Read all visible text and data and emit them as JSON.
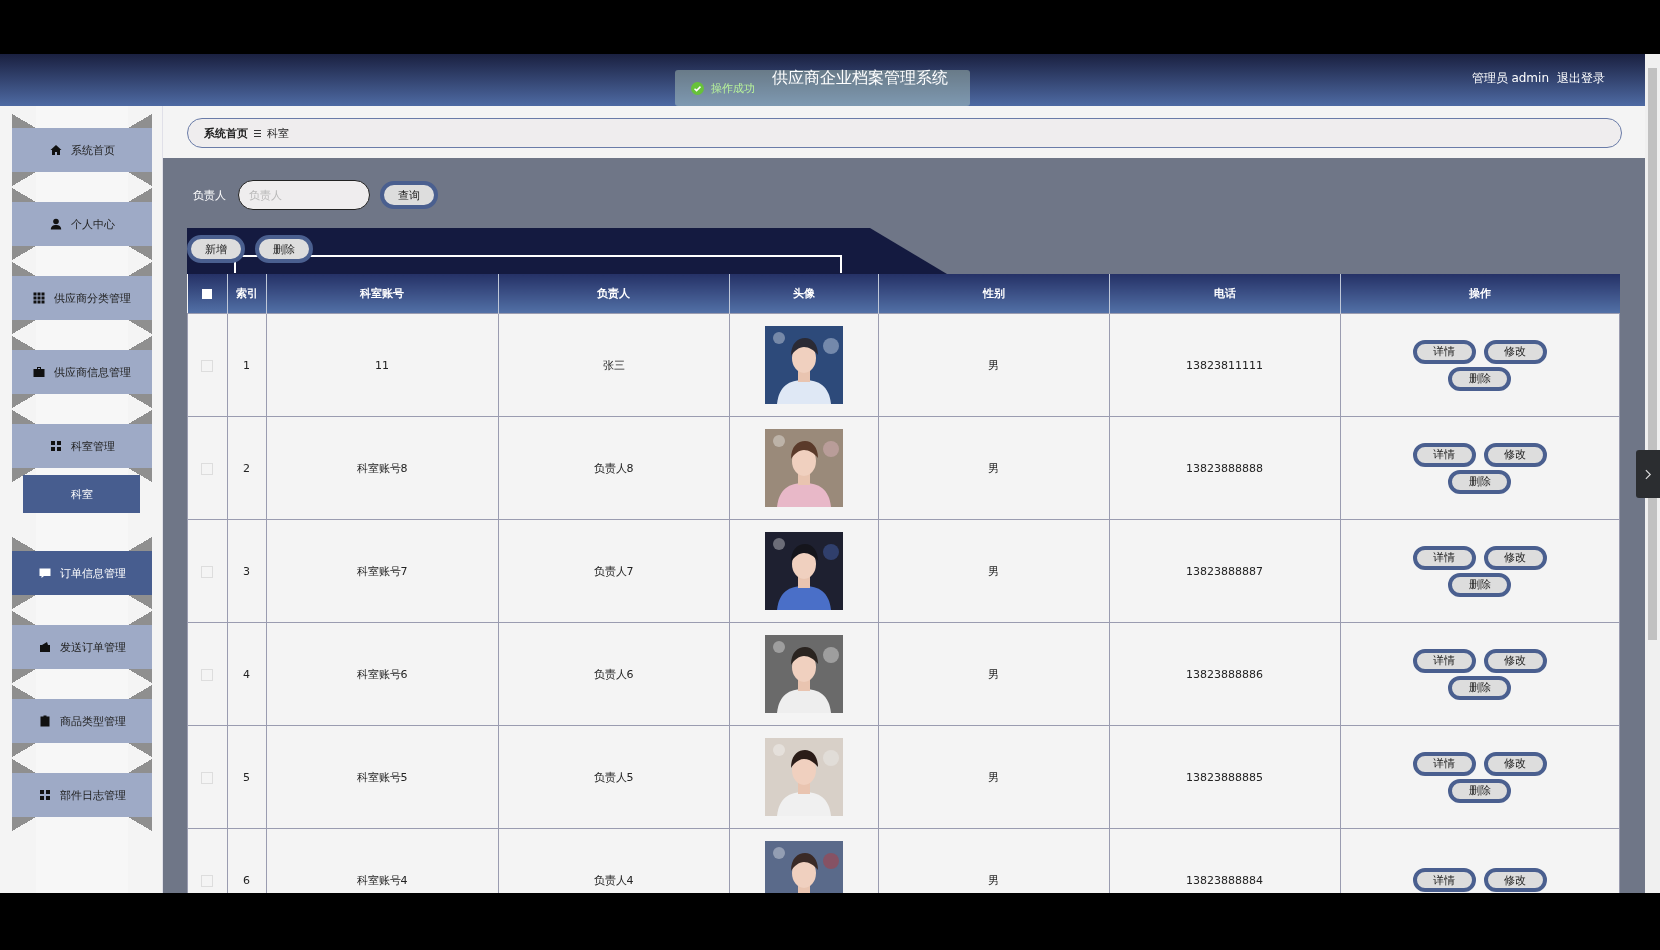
{
  "header": {
    "title": "供应商企业档案管理系统",
    "user": "管理员 admin",
    "logout": "退出登录"
  },
  "toast": {
    "message": "操作成功"
  },
  "sidebar": {
    "items": [
      {
        "label": "系统首页",
        "selected": false
      },
      {
        "label": "个人中心",
        "selected": false
      },
      {
        "label": "供应商分类管理",
        "selected": false
      },
      {
        "label": "供应商信息管理",
        "selected": false
      },
      {
        "label": "科室管理",
        "selected": false,
        "children": [
          {
            "label": "科室",
            "selected": true
          }
        ]
      },
      {
        "label": "订单信息管理",
        "selected": true
      },
      {
        "label": "发送订单管理",
        "selected": false
      },
      {
        "label": "商品类型管理",
        "selected": false
      },
      {
        "label": "部件日志管理",
        "selected": false
      }
    ]
  },
  "breadcrumb": [
    "系统首页",
    "科室"
  ],
  "search": {
    "label": "负责人",
    "placeholder": "负责人",
    "button": "查询"
  },
  "toolbar": [
    "新增",
    "删除"
  ],
  "table": {
    "all_checked": false,
    "columns": [
      "索引",
      "科室账号",
      "负责人",
      "头像",
      "性别",
      "电话",
      "操作"
    ],
    "rows": [
      {
        "checked": false,
        "index": "1",
        "account": "11",
        "person": "张三",
        "avatar": {
          "kind": "picture"
        },
        "gender": "男",
        "phone": "13823811111",
        "actions": [
          "详情",
          "修改",
          "删除"
        ]
      },
      {
        "checked": false,
        "index": "2",
        "account": "科室账号8",
        "person": "负责人8",
        "avatar": {
          "kind": "picture"
        },
        "gender": "男",
        "phone": "13823888888",
        "actions": [
          "详情",
          "修改",
          "删除"
        ]
      },
      {
        "checked": false,
        "index": "3",
        "account": "科室账号7",
        "person": "负责人7",
        "avatar": {
          "kind": "picture"
        },
        "gender": "男",
        "phone": "13823888887",
        "actions": [
          "详情",
          "修改",
          "删除"
        ]
      },
      {
        "checked": false,
        "index": "4",
        "account": "科室账号6",
        "person": "负责人6",
        "avatar": {
          "kind": "picture"
        },
        "gender": "男",
        "phone": "13823888886",
        "actions": [
          "详情",
          "修改",
          "删除"
        ]
      },
      {
        "checked": false,
        "index": "5",
        "account": "科室账号5",
        "person": "负责人5",
        "avatar": {
          "kind": "picture"
        },
        "gender": "男",
        "phone": "13823888885",
        "actions": [
          "详情",
          "修改",
          "删除"
        ]
      },
      {
        "checked": false,
        "index": "6",
        "account": "科室账号4",
        "person": "负责人4",
        "avatar": {
          "kind": "picture"
        },
        "gender": "男",
        "phone": "13823888884",
        "actions": [
          "详情",
          "修改"
        ]
      }
    ]
  }
}
